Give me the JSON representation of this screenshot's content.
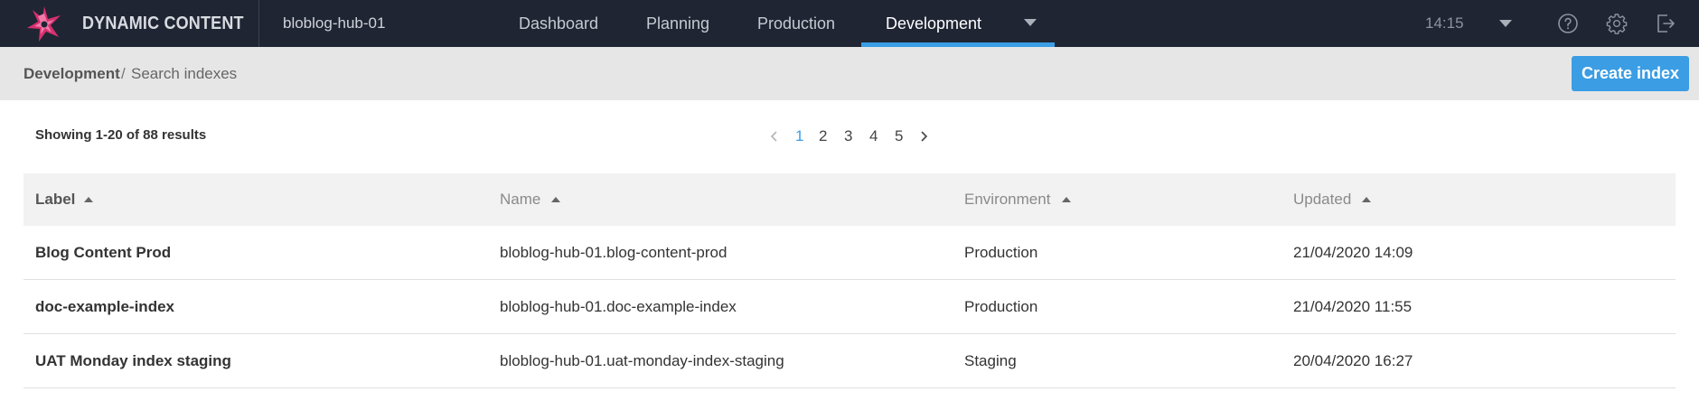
{
  "brand": {
    "name": "DYNAMIC CONTENT",
    "hub": "bloblog-hub-01"
  },
  "nav": {
    "tabs": [
      {
        "label": "Dashboard"
      },
      {
        "label": "Planning"
      },
      {
        "label": "Production"
      },
      {
        "label": "Development",
        "active": true
      }
    ],
    "time": "14:15",
    "icons": [
      "help-icon",
      "settings-gear-icon",
      "logout-icon"
    ],
    "accent": "#3a9ee6"
  },
  "breadcrumb": {
    "root": "Development",
    "separator": "/",
    "current": "Search indexes"
  },
  "actions": {
    "create_label": "Create index",
    "create_color": "#3b9de4"
  },
  "results": {
    "summary": "Showing 1-20 of 88 results"
  },
  "pagination": {
    "pages": [
      "1",
      "2",
      "3",
      "4",
      "5"
    ],
    "current": "1"
  },
  "table": {
    "columns": [
      "Label",
      "Name",
      "Environment",
      "Updated"
    ],
    "rows": [
      {
        "label": "Blog Content Prod",
        "name": "bloblog-hub-01.blog-content-prod",
        "environment": "Production",
        "updated": "21/04/2020 14:09"
      },
      {
        "label": "doc-example-index",
        "name": "bloblog-hub-01.doc-example-index",
        "environment": "Production",
        "updated": "21/04/2020 11:55"
      },
      {
        "label": "UAT Monday index staging",
        "name": "bloblog-hub-01.uat-monday-index-staging",
        "environment": "Staging",
        "updated": "20/04/2020 16:27"
      }
    ]
  }
}
